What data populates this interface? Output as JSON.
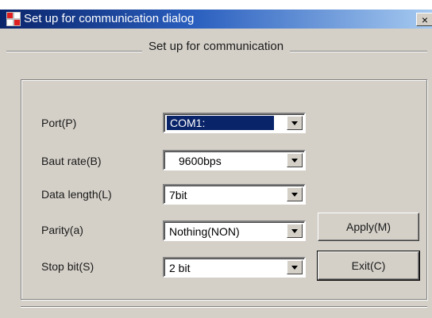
{
  "window": {
    "title": "Set up for communication dialog",
    "close_label": "×"
  },
  "dialog": {
    "header": "Set up for communication"
  },
  "fields": [
    {
      "label": "Port(P)",
      "value": "COM1:"
    },
    {
      "label": "Baut rate(B)",
      "value": "9600bps"
    },
    {
      "label": "Data length(L)",
      "value": "7bit"
    },
    {
      "label": "Parity(a)",
      "value": "Nothing(NON)"
    },
    {
      "label": "Stop bit(S)",
      "value": "2 bit"
    }
  ],
  "buttons": {
    "apply": "Apply(M)",
    "exit": "Exit(C)"
  },
  "colors": {
    "titlebar_start": "#0a246a",
    "titlebar_end": "#a6caf0",
    "face": "#d4d0c8",
    "selection": "#0a246a"
  }
}
